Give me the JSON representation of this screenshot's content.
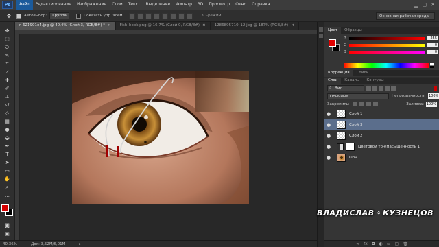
{
  "menubar": {
    "app_logo": "Ps",
    "items": [
      "Файл",
      "Редактирование",
      "Изображение",
      "Слои",
      "Текст",
      "Выделение",
      "Фильтр",
      "3D",
      "Просмотр",
      "Окно",
      "Справка"
    ],
    "active_index": 0
  },
  "options_bar": {
    "autoselect_label": "Автовыбор:",
    "autoselect_target": "Группа",
    "show_controls_label": "Показать упр. элем.",
    "mode_3d_label": "3D-режим:",
    "workspace": "Основная рабочая среда"
  },
  "document_tabs": [
    {
      "label": "r_621901e4.jpg @ 40,4% (Слой 3, RGB/8#) *",
      "active": true
    },
    {
      "label": "Fish_hook.png @ 16,7% (Слой 0, RGB/8#)",
      "active": false
    },
    {
      "label": "1286895710_12.jpg @ 187% (RGB/8#)",
      "active": false
    }
  ],
  "status_bar": {
    "zoom": "40,36%",
    "doc_size": "Док: 3,52M/6,01M"
  },
  "color_panel": {
    "tabs": [
      "Цвет",
      "Образцы"
    ],
    "active_tab": 0,
    "foreground": "#e00000",
    "background": "#000000",
    "sliders": [
      {
        "label": "R",
        "value": "255"
      },
      {
        "label": "G",
        "value": "0"
      },
      {
        "label": "B",
        "value": "0"
      }
    ]
  },
  "adjust_panel": {
    "tabs": [
      "Коррекция",
      "Стили"
    ],
    "active_tab": 0
  },
  "layers_panel": {
    "tabs": [
      "Слои",
      "Каналы",
      "Контуры"
    ],
    "active_tab": 0,
    "kind_label": "Вид",
    "blend_mode": "Обычные",
    "opacity_label": "Непрозрачность:",
    "opacity_value": "100%",
    "lock_label": "Закрепить:",
    "fill_label": "Заливка:",
    "fill_value": "100%",
    "layers": [
      {
        "name": "Слой 1",
        "type": "pixel",
        "selected": false
      },
      {
        "name": "Слой 3",
        "type": "pixel",
        "selected": true
      },
      {
        "name": "Слой 2",
        "type": "pixel",
        "selected": false
      },
      {
        "name": "Цветовой тон/Насыщенность 1",
        "type": "adjustment",
        "selected": false
      },
      {
        "name": "Фон",
        "type": "photo",
        "selected": false
      }
    ],
    "footer_icons": [
      "link-icon",
      "fx-icon",
      "mask-icon",
      "adjustment-icon",
      "folder-icon",
      "new-layer-icon",
      "trash-icon"
    ],
    "footer_glyphs": [
      "∞",
      "fx",
      "◘",
      "◐",
      "▭",
      "▢",
      "🗑"
    ]
  },
  "watermark": {
    "left": "ВЛАДИСЛАВ",
    "right": "КУЗНЕЦОВ"
  }
}
